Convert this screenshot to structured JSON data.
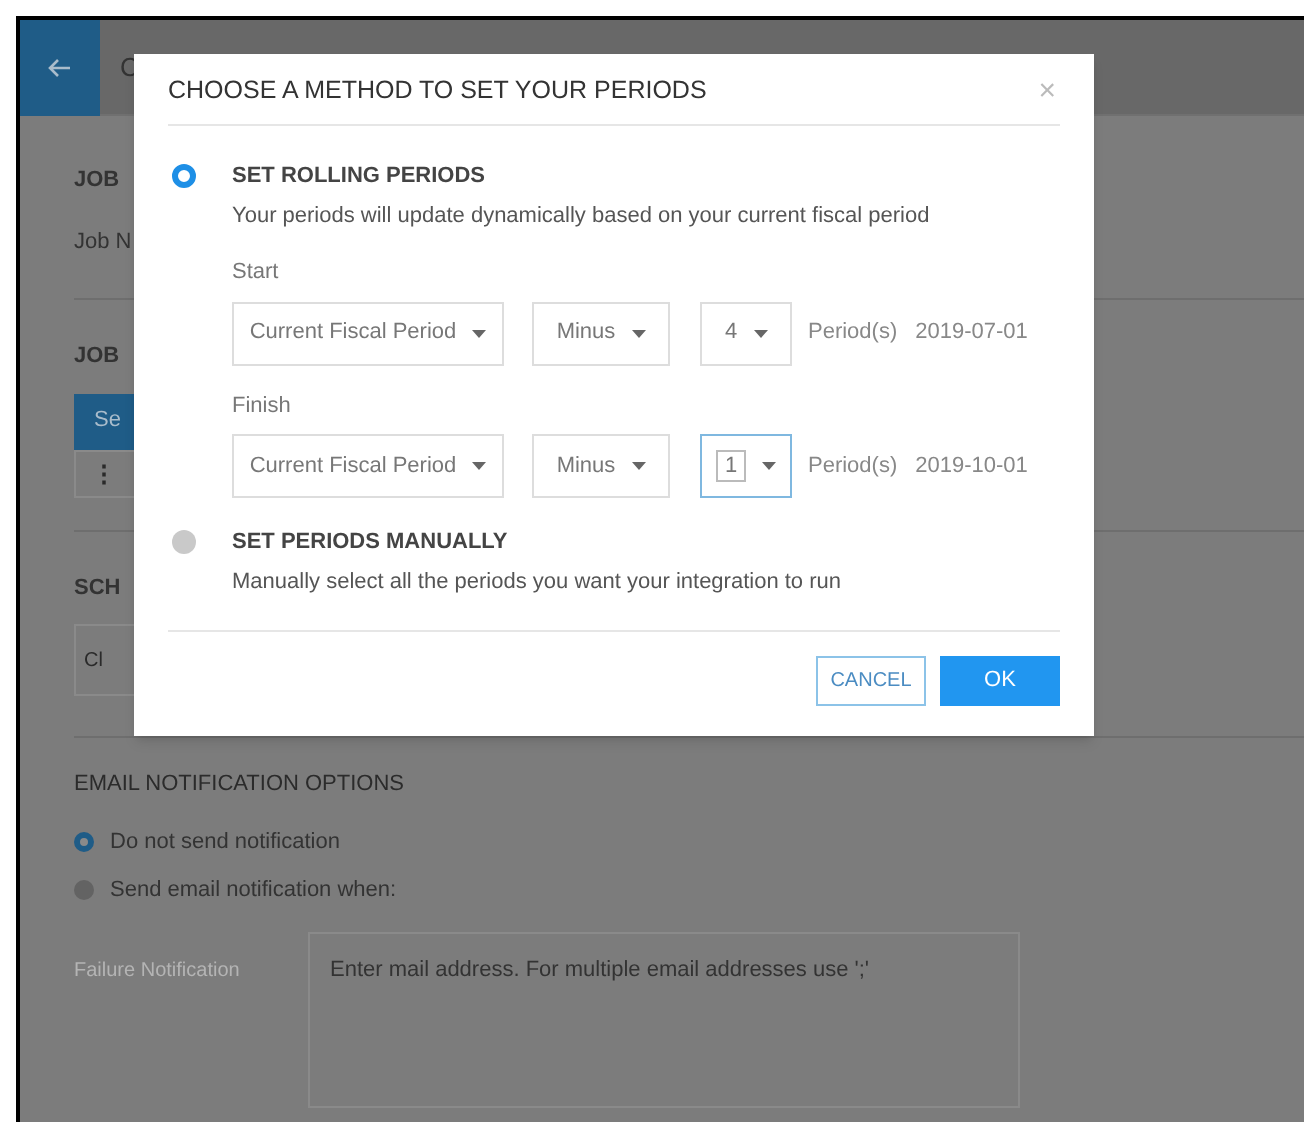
{
  "header": {
    "title": "C"
  },
  "background_sections": [
    {
      "title": "JOB",
      "label": "Job N"
    },
    {
      "title": "JOB",
      "button": "Se",
      "row_icon": "⋮"
    },
    {
      "title": "SCH",
      "field": "Cl"
    }
  ],
  "email_notification": {
    "title": "EMAIL NOTIFICATION OPTIONS",
    "options": [
      {
        "label": "Do not send notification",
        "selected": true
      },
      {
        "label": "Send email notification when:",
        "selected": false
      }
    ],
    "failure_label": "Failure Notification",
    "address_placeholder": "Enter mail address. For multiple email addresses use ';'"
  },
  "dialog": {
    "title": "CHOOSE A METHOD TO SET YOUR PERIODS",
    "close": "×",
    "methods": [
      {
        "kind": "rolling",
        "title": "SET ROLLING PERIODS",
        "description": "Your periods will update dynamically based on your current fiscal period",
        "selected": true,
        "rows": [
          {
            "label": "Start",
            "base": "Current Fiscal Period",
            "operator": "Minus",
            "count": "4",
            "unit": "Period(s)",
            "date": "2019-07-01",
            "focused": false
          },
          {
            "label": "Finish",
            "base": "Current Fiscal Period",
            "operator": "Minus",
            "count": "1",
            "unit": "Period(s)",
            "date": "2019-10-01",
            "focused": true
          }
        ]
      },
      {
        "kind": "manual",
        "title": "SET PERIODS MANUALLY",
        "description": "Manually select all the periods you want your integration to run",
        "selected": false
      }
    ],
    "buttons": [
      {
        "label": "CANCEL",
        "kind": "secondary"
      },
      {
        "label": "OK",
        "kind": "primary"
      }
    ]
  }
}
